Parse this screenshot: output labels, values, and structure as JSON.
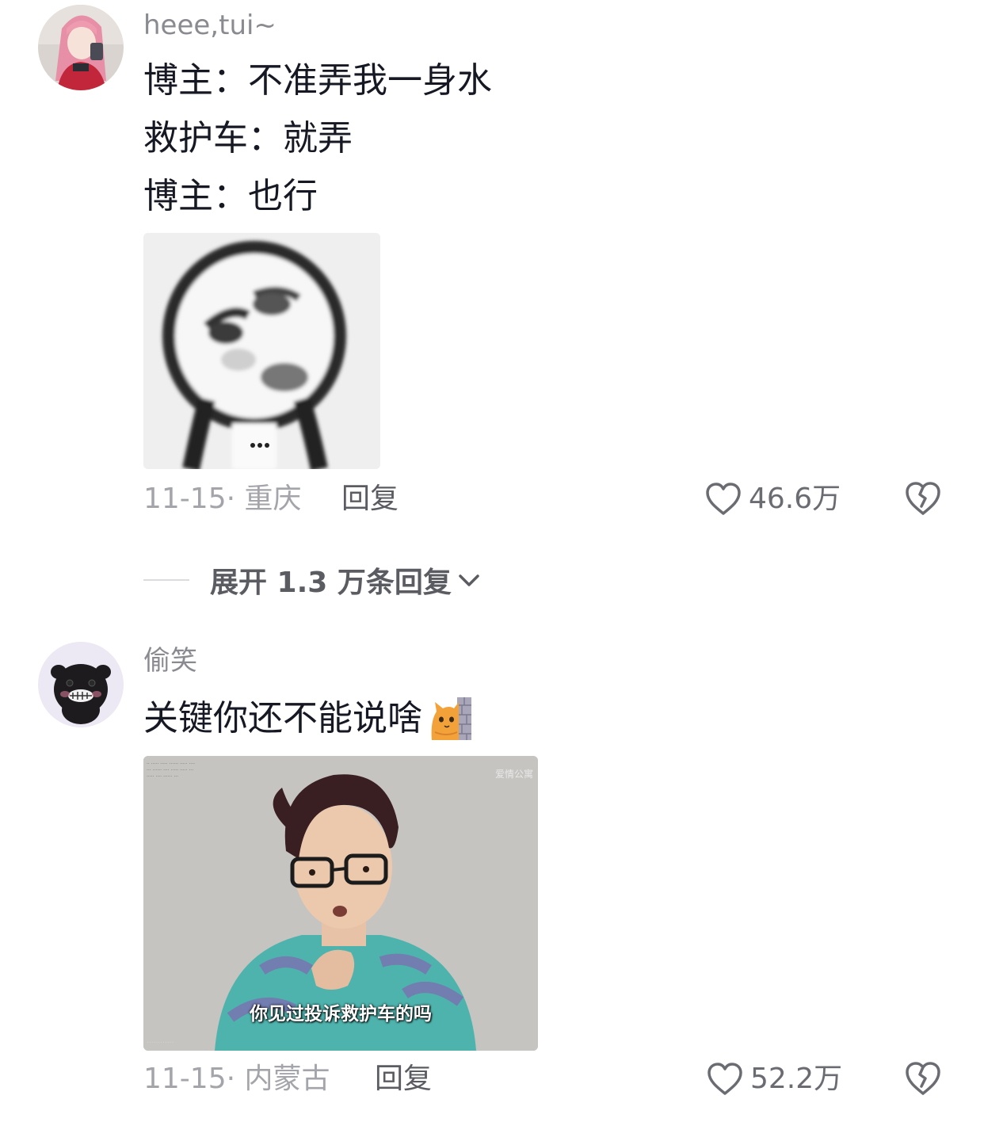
{
  "comments": [
    {
      "username": "heee,tui~",
      "lines": [
        "博主：不准弄我一身水",
        "救护车：就弄",
        "博主：也行"
      ],
      "image_caption": "",
      "date_location": "11-15· 重庆",
      "reply_label": "回复",
      "like_count": "46.6万"
    },
    {
      "username": "偷笑",
      "lines": [
        "关键你还不能说啥"
      ],
      "emoji": "cat-peek-emoji",
      "image_caption": "你见过投诉救护车的吗",
      "image_watermark": "爱情公寓",
      "date_location": "11-15· 内蒙古",
      "reply_label": "回复",
      "like_count": "52.2万"
    }
  ],
  "expand_replies": {
    "label": "展开 1.3 万条回复"
  },
  "colors": {
    "username": "#8a8b91",
    "body_text": "#161823",
    "meta": "#a4a5aa",
    "action": "#5b5c62"
  },
  "icons": {
    "like": "heart-outline-icon",
    "dislike": "broken-heart-icon",
    "expand": "chevron-down-icon"
  }
}
